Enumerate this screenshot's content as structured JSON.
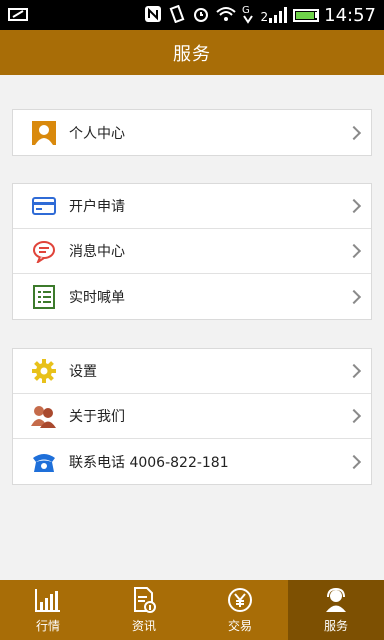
{
  "status_bar": {
    "time": "14:57",
    "signal_label": "2"
  },
  "header": {
    "title": "服务"
  },
  "groups": [
    {
      "items": [
        {
          "label": "个人中心",
          "icon": "person-icon"
        }
      ]
    },
    {
      "items": [
        {
          "label": "开户申请",
          "icon": "card-icon"
        },
        {
          "label": "消息中心",
          "icon": "message-icon"
        },
        {
          "label": "实时喊单",
          "icon": "list-icon"
        }
      ]
    },
    {
      "items": [
        {
          "label": "设置",
          "icon": "gear-icon"
        },
        {
          "label": "关于我们",
          "icon": "people-icon"
        },
        {
          "label": "联系电话  4006-822-181",
          "icon": "phone-icon"
        }
      ]
    }
  ],
  "tabs": [
    {
      "label": "行情",
      "icon": "bar-chart-icon"
    },
    {
      "label": "资讯",
      "icon": "document-icon"
    },
    {
      "label": "交易",
      "icon": "yuan-coin-icon"
    },
    {
      "label": "服务",
      "icon": "service-agent-icon",
      "active": true
    }
  ],
  "colors": {
    "brand": "#a86d07",
    "tab_active": "#7d5002"
  }
}
